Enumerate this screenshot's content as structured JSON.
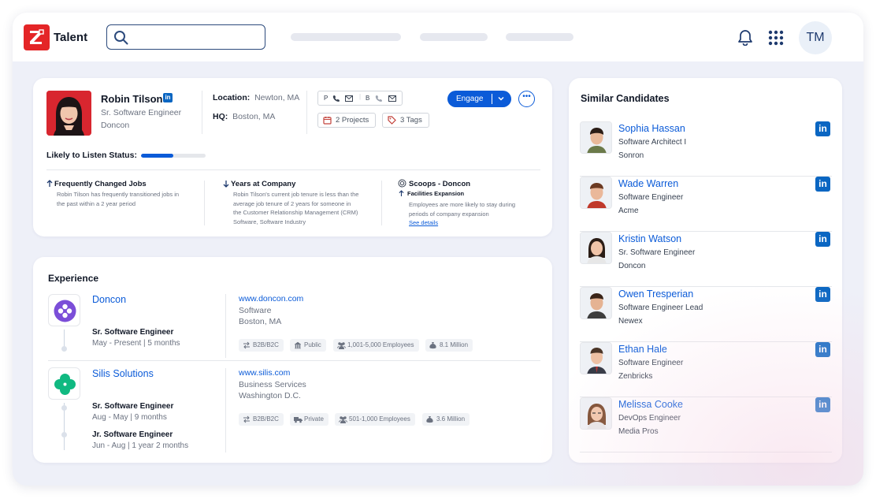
{
  "app": {
    "brand": "Talent",
    "avatar_initials": "TM",
    "search_placeholder": ""
  },
  "profile": {
    "name": "Robin Tilson",
    "title": "Sr. Software Engineer",
    "company": "Doncon",
    "location_label": "Location:",
    "location": "Newton, MA",
    "hq_label": "HQ:",
    "hq": "Boston, MA",
    "contact": {
      "p": "P",
      "b": "B"
    },
    "projects": "2 Projects",
    "tags": "3 Tags",
    "engage": "Engage",
    "more": "•••",
    "listen_label": "Likely to Listen Status:",
    "listen_level": 0.5
  },
  "insights": [
    {
      "title": "Frequently Changed Jobs",
      "body": [
        "Robin Tilson has frequently transitioned jobs in",
        "the past within a 2 year period"
      ]
    },
    {
      "title": "Years at Company",
      "body": [
        "Robin Tilson's current job tenure is less than the",
        "average job tenure of 2 years for someone in",
        "the Customer Relationship Management (CRM)",
        "Software, Software Industry"
      ]
    },
    {
      "title": "Scoops - Doncon",
      "subtitle": "Facilities Expansion",
      "body": [
        "Employees are more likely to stay during",
        "periods of company expansion"
      ],
      "link": "See details"
    }
  ],
  "experience": {
    "title": "Experience",
    "items": [
      {
        "company": "Doncon",
        "roles": [
          {
            "title": "Sr. Software Engineer",
            "period": "May - Present | 5 months"
          }
        ],
        "website": "www.doncon.com",
        "industry": "Software",
        "location": "Boston, MA",
        "tags": [
          "B2B/B2C",
          "Public",
          "1,001-5,000 Employees",
          "8.1 Million"
        ]
      },
      {
        "company": "Silis Solutions",
        "roles": [
          {
            "title": "Sr. Software Engineer",
            "period": "Aug - May | 9 months"
          },
          {
            "title": "Jr. Software Engineer",
            "period": "Jun - Aug | 1 year 2 months"
          }
        ],
        "website": "www.silis.com",
        "industry": "Business Services",
        "location": "Washington D.C.",
        "tags": [
          "B2B/B2C",
          "Private",
          "501-1,000 Employees",
          "3.6 Million"
        ]
      }
    ]
  },
  "similar": {
    "title": "Similar Candidates",
    "li": "in",
    "candidates": [
      {
        "name": "Sophia Hassan",
        "role": "Software Architect I",
        "company": "Sonron"
      },
      {
        "name": "Wade Warren",
        "role": "Software Engineer",
        "company": "Acme"
      },
      {
        "name": "Kristin Watson",
        "role": "Sr. Software Engineer",
        "company": "Doncon"
      },
      {
        "name": "Owen  Tresperian",
        "role": "Software Engineer Lead",
        "company": "Newex"
      },
      {
        "name": "Ethan Hale",
        "role": "Software Engineer",
        "company": "Zenbricks"
      },
      {
        "name": "Melissa Cooke",
        "role": "DevOps Engineer",
        "company": "Media Pros"
      }
    ]
  }
}
